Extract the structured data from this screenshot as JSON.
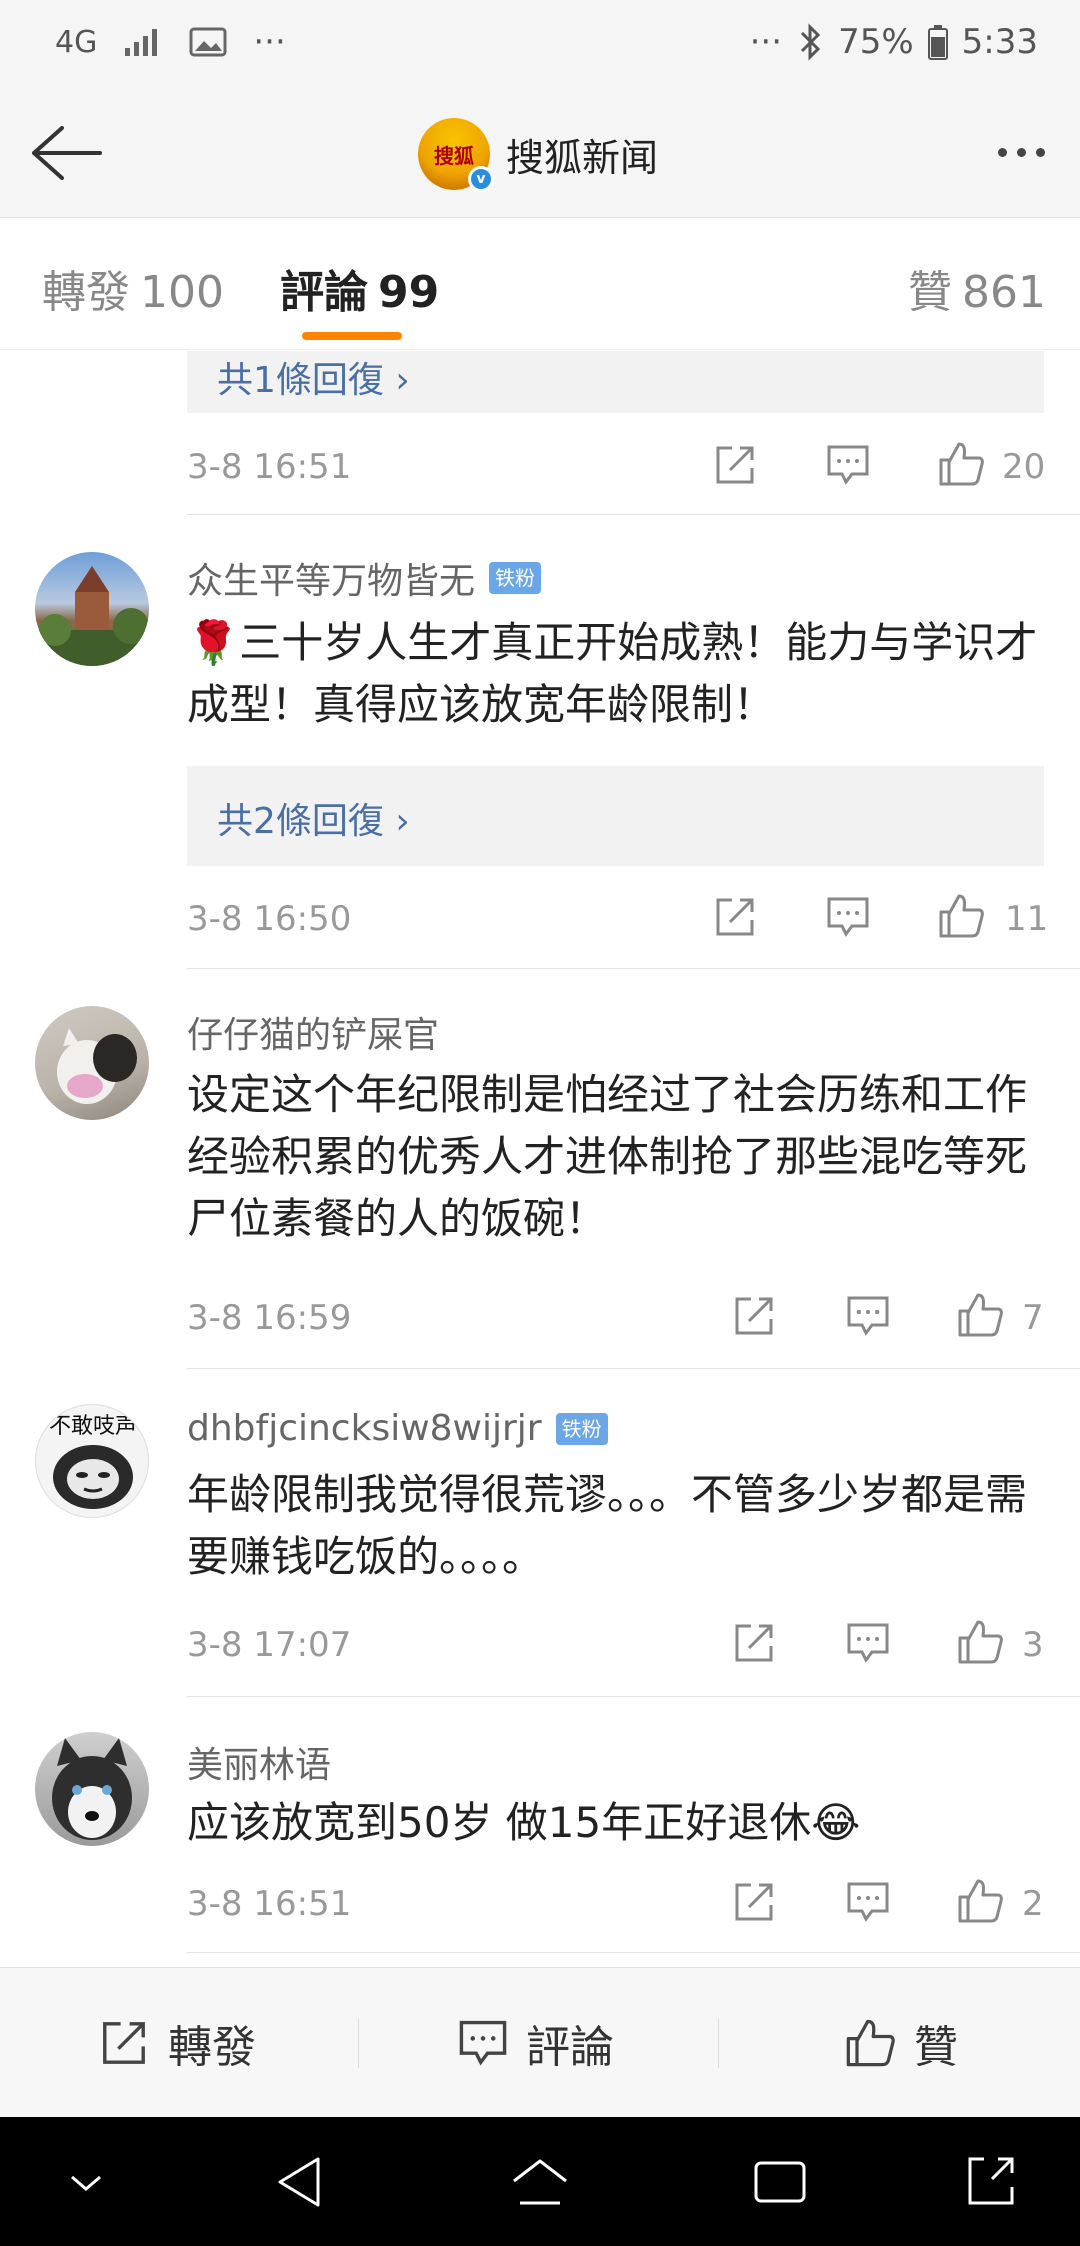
{
  "status_bar": {
    "network": "4G",
    "signal_icon": "signal-bars-icon",
    "image_icon": "image-icon",
    "overflow_left": "···",
    "overflow_right": "···",
    "bluetooth_icon": "bluetooth-icon",
    "battery": "75%",
    "time": "5:33"
  },
  "header": {
    "title": "搜狐新闻",
    "logo_text": "搜狐"
  },
  "tabs": [
    {
      "label": "轉發",
      "count": "100"
    },
    {
      "label": "評論",
      "count": "99"
    },
    {
      "label": "贊",
      "count": "861"
    }
  ],
  "comments_prev": {
    "reply_link": "共1條回復 ›",
    "time": "3-8 16:51",
    "likes": "20"
  },
  "comments": [
    {
      "username": "众生平等万物皆无",
      "badge": "铁粉",
      "text": "🌹三十岁人生才真正开始成熟！能力与学识才成型！真得应该放宽年龄限制！",
      "reply_link": "共2條回復 ›",
      "time": "3-8 16:50",
      "likes": "11"
    },
    {
      "username": "仔仔猫的铲屎官",
      "badge": "",
      "text": "设定这个年纪限制是怕经过了社会历练和工作经验积累的优秀人才进体制抢了那些混吃等死尸位素餐的人的饭碗！",
      "time": "3-8 16:59",
      "likes": "7"
    },
    {
      "username": "dhbfjcincksiw8wijrjr",
      "badge": "铁粉",
      "avatar_text": "不敢吱声",
      "text": "年龄限制我觉得很荒谬。。。不管多少岁都是需要赚钱吃饭的。。。。",
      "time": "3-8 17:07",
      "likes": "3"
    },
    {
      "username": "美丽林语",
      "badge": "",
      "text": "应该放宽到50岁 做15年正好退休😂",
      "time": "3-8 16:51",
      "likes": "2"
    }
  ],
  "bottom_bar": {
    "repost": "轉發",
    "comment": "評論",
    "like": "贊"
  },
  "colors": {
    "accent": "#ff8200",
    "link": "#4a6fa5",
    "badge": "#6ba6e6"
  }
}
